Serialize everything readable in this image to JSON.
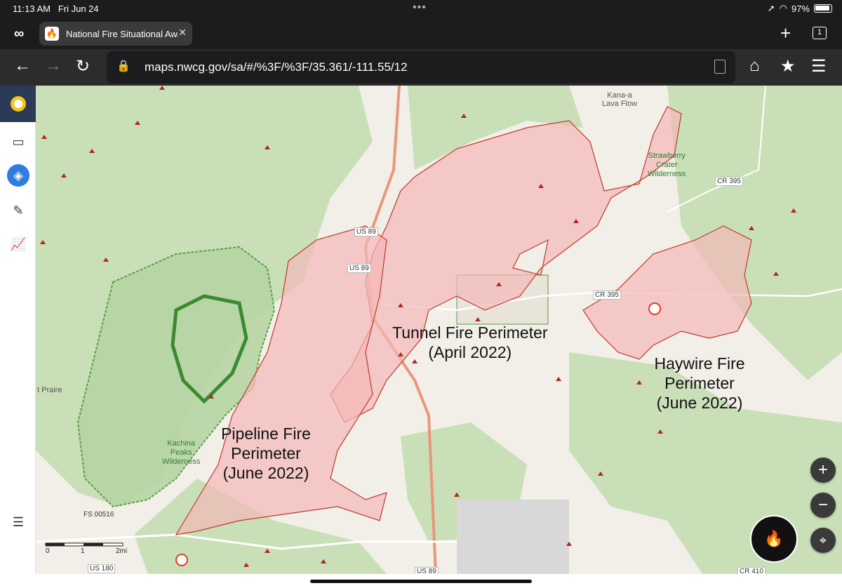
{
  "status": {
    "time": "11:13 AM",
    "date": "Fri Jun 24",
    "battery": "97%"
  },
  "browser": {
    "tab_title": "National Fire Situational Awa",
    "tab_count": "1",
    "url": "maps.nwcg.gov/sa/#/%3F/%3F/35.361/-111.55/12"
  },
  "map": {
    "perimeters": [
      {
        "label_line1": "Tunnel Fire Perimeter",
        "label_line2": "(April 2022)"
      },
      {
        "label_line1": "Haywire Fire",
        "label_line2": "Perimeter",
        "label_line3": "(June 2022)"
      },
      {
        "label_line1": "Pipeline Fire",
        "label_line2": "Perimeter",
        "label_line3": "(June 2022)"
      }
    ],
    "places": {
      "kana_a": "Kana-a Lava Flow",
      "strawberry_1": "Strawberry",
      "strawberry_2": "Crater",
      "strawberry_3": "Wilderness",
      "kachina_1": "Kachina",
      "kachina_2": "Peaks",
      "kachina_3": "Wilderness",
      "prairie": "t Praire"
    },
    "roads": {
      "us89_a": "US 89",
      "us89_b": "US 89",
      "us89_c": "US 89",
      "cr395_a": "CR 395",
      "cr395_b": "CR 395",
      "fs": "FS 00516",
      "us180": "US 180",
      "cr410": "CR 410"
    },
    "scale": {
      "s0": "0",
      "s1": "1",
      "s2": "2mi"
    },
    "colors": {
      "perimeter_fill": "#f4b8b8",
      "perimeter_stroke": "#c0392b",
      "forest": "#c9dfb8",
      "wilderness_border": "#4a9a3a",
      "hotspot": "#b5261e"
    }
  },
  "controls": {
    "zoom_in": "+",
    "zoom_out": "−",
    "locate_icon": "crosshair-icon"
  },
  "sidebar": {
    "icons": [
      "presentation-icon",
      "layers-icon",
      "pencil-icon",
      "chart-icon",
      "list-icon"
    ]
  }
}
